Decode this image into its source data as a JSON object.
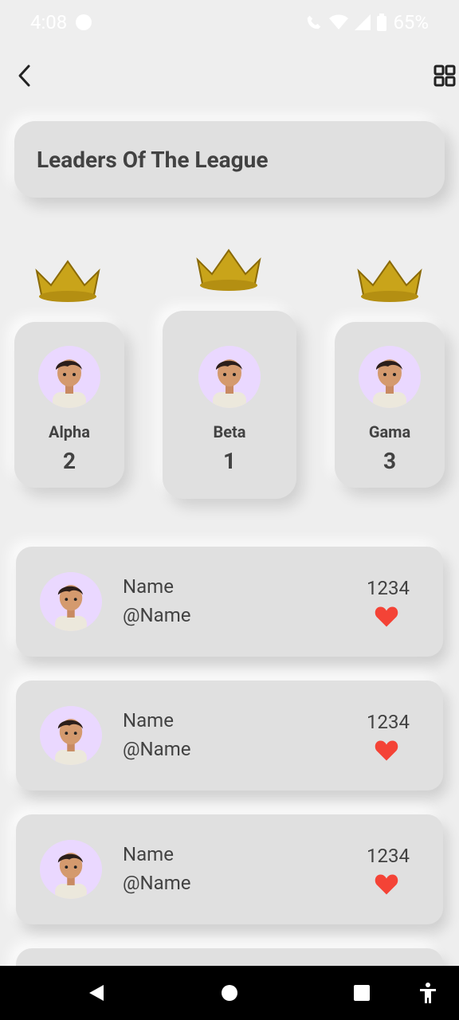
{
  "status_bar": {
    "time": "4:08",
    "battery": "65%"
  },
  "header": {
    "title": "Leaders Of The League"
  },
  "podium": [
    {
      "name": "Alpha",
      "rank": "2"
    },
    {
      "name": "Beta",
      "rank": "1"
    },
    {
      "name": "Gama",
      "rank": "3"
    }
  ],
  "leaderboard": [
    {
      "name": "Name",
      "handle": "@Name",
      "score": "1234"
    },
    {
      "name": "Name",
      "handle": "@Name",
      "score": "1234"
    },
    {
      "name": "Name",
      "handle": "@Name",
      "score": "1234"
    }
  ],
  "colors": {
    "heart": "#f44336",
    "avatar_bg": "#ead8ff",
    "card_bg": "#e0e0e0",
    "crown": "#c9a41a"
  },
  "icons": [
    "back-arrow-icon",
    "grid-view-icon",
    "crown-icon",
    "heart-icon",
    "avatar-icon"
  ]
}
